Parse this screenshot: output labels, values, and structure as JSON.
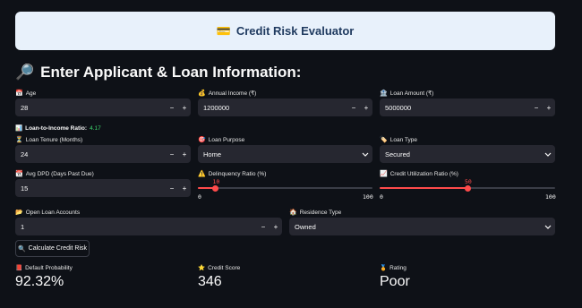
{
  "banner": {
    "icon": "💳",
    "title": "Credit Risk Evaluator"
  },
  "section": {
    "icon": "🔎",
    "title": "Enter Applicant & Loan Information:"
  },
  "fields": {
    "age": {
      "icon": "📅",
      "label": "Age",
      "value": "28"
    },
    "income": {
      "icon": "💰",
      "label": "Annual Income (₹)",
      "value": "1200000"
    },
    "loan_amount": {
      "icon": "🏦",
      "label": "Loan Amount (₹)",
      "value": "5000000"
    },
    "tenure": {
      "icon": "⏳",
      "label": "Loan Tenure (Months)",
      "value": "24"
    },
    "purpose": {
      "icon": "🎯",
      "label": "Loan Purpose",
      "value": "Home"
    },
    "loan_type": {
      "icon": "🏷️",
      "label": "Loan Type",
      "value": "Secured"
    },
    "avg_dpd": {
      "icon": "📆",
      "label": "Avg DPD (Days Past Due)",
      "value": "15"
    },
    "delinquency": {
      "icon": "⚠️",
      "label": "Delinquency Ratio (%)",
      "value": 10,
      "min": "0",
      "max": "100"
    },
    "utilization": {
      "icon": "📈",
      "label": "Credit Utilization Ratio (%)",
      "value": 50,
      "min": "0",
      "max": "100"
    },
    "open_accounts": {
      "icon": "📂",
      "label": "Open Loan Accounts",
      "value": "1"
    },
    "residence": {
      "icon": "🏠",
      "label": "Residence Type",
      "value": "Owned"
    }
  },
  "ratio": {
    "icon": "📊",
    "label": "Loan-to-Income Ratio:",
    "value": "4.17"
  },
  "button": {
    "icon": "🔍",
    "label": "Calculate Credit Risk"
  },
  "stepper": {
    "minus": "−",
    "plus": "+"
  },
  "results": {
    "default_prob": {
      "icon": "📕",
      "label": "Default Probability",
      "value": "92.32%"
    },
    "credit_score": {
      "icon": "⭐",
      "label": "Credit Score",
      "value": "346"
    },
    "rating": {
      "icon": "🏅",
      "label": "Rating",
      "value": "Poor"
    }
  },
  "colors": {
    "accent": "#ff4b4b",
    "ratio_value": "#3dd56d",
    "banner_bg": "#e8f1fb"
  }
}
